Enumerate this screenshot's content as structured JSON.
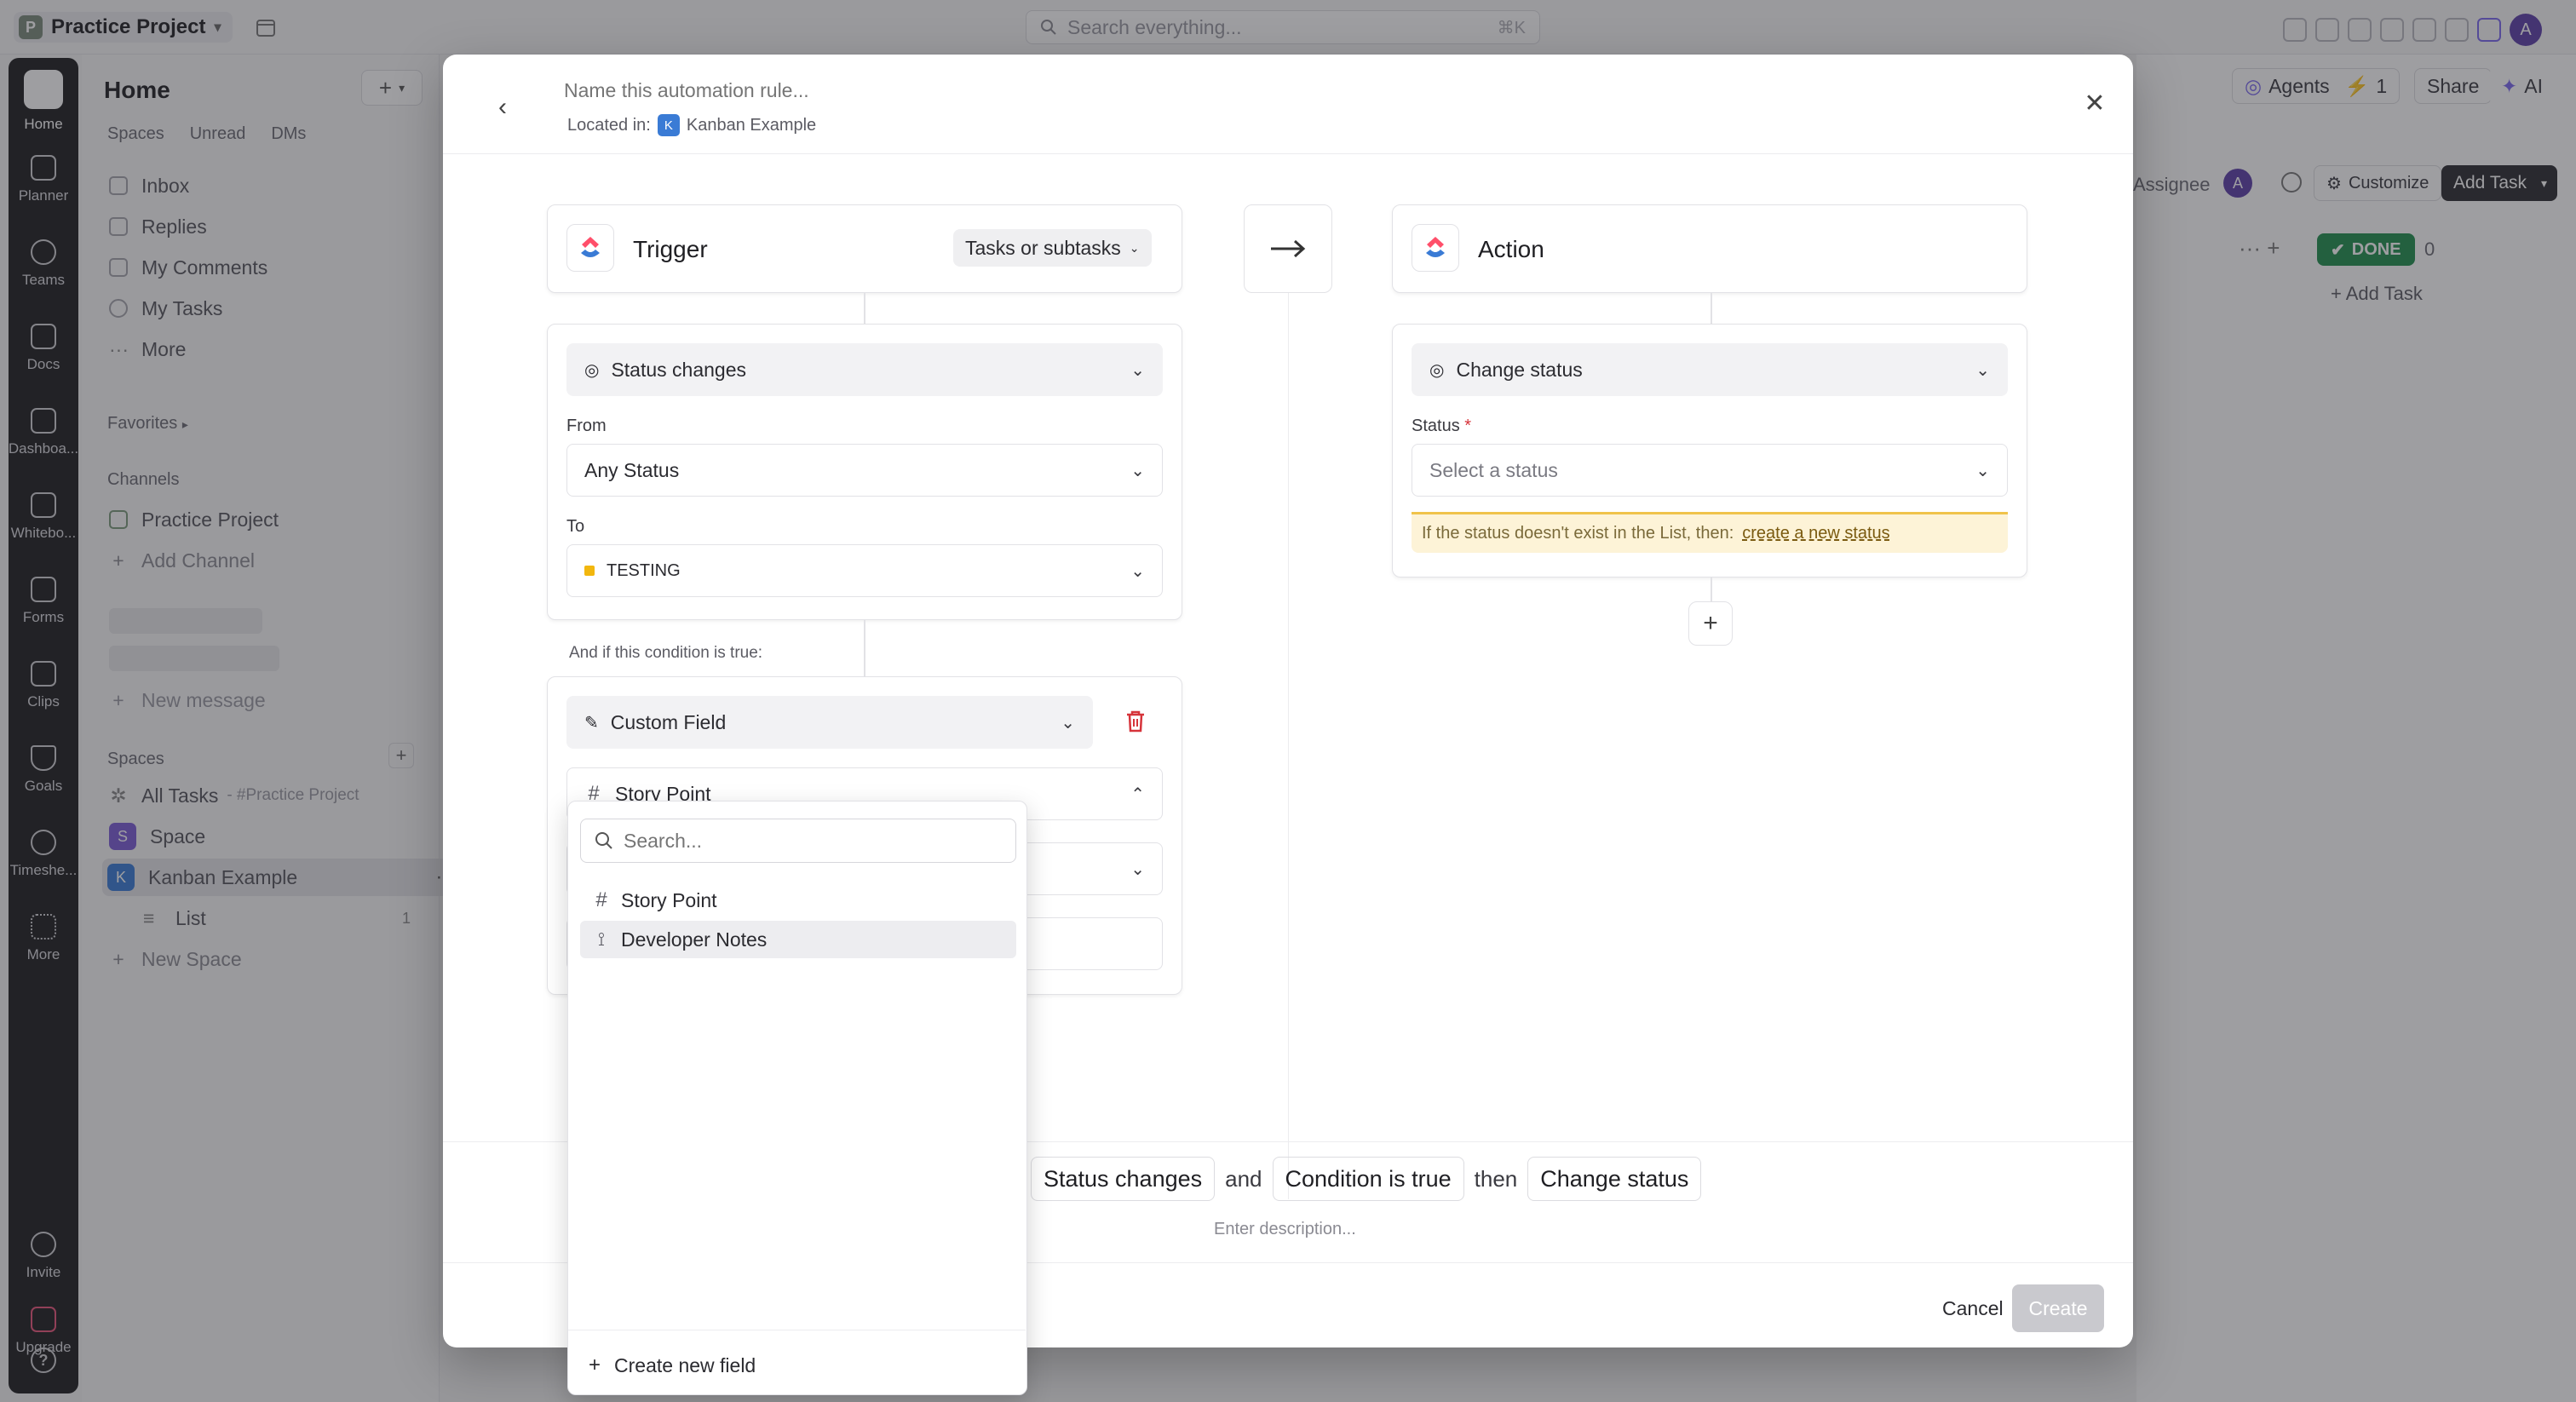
{
  "topbar": {
    "workspace_badge": "P",
    "workspace_name": "Practice Project",
    "search_placeholder": "Search everything...",
    "search_shortcut": "⌘K",
    "user_initial": "A"
  },
  "rail": {
    "items": [
      {
        "label": "Home",
        "icon": "home-icon"
      },
      {
        "label": "Planner",
        "icon": "calendar-icon"
      },
      {
        "label": "Teams",
        "icon": "teams-icon"
      },
      {
        "label": "Docs",
        "icon": "docs-icon"
      },
      {
        "label": "Dashboa...",
        "icon": "dashboard-icon"
      },
      {
        "label": "Whitebo...",
        "icon": "whiteboard-icon"
      },
      {
        "label": "Forms",
        "icon": "forms-icon"
      },
      {
        "label": "Clips",
        "icon": "clips-icon"
      },
      {
        "label": "Goals",
        "icon": "trophy-icon"
      },
      {
        "label": "Timeshe...",
        "icon": "clock-icon"
      },
      {
        "label": "More",
        "icon": "grid-icon"
      }
    ],
    "invite": "Invite",
    "upgrade": "Upgrade",
    "help": "?"
  },
  "sidebar": {
    "title": "Home",
    "tabs": [
      "Spaces",
      "Unread",
      "DMs"
    ],
    "nav": [
      "Inbox",
      "Replies",
      "My Comments",
      "My Tasks",
      "More"
    ],
    "favorites": "Favorites",
    "channels_heading": "Channels",
    "channel": "Practice Project",
    "add_channel": "Add Channel",
    "new_message": "New message",
    "spaces_heading": "Spaces",
    "all_tasks": "All Tasks",
    "all_tasks_suffix": "- #Practice Project",
    "space": "Space",
    "space_badge": "S",
    "kanban": "Kanban Example",
    "kanban_badge": "K",
    "list": "List",
    "list_count": "1",
    "new_space": "New Space"
  },
  "background": {
    "agents": "Agents",
    "bolt_count": "1",
    "share": "Share",
    "ai": "AI",
    "assignee": "Assignee",
    "assignee_initial": "A",
    "customize": "Customize",
    "add_task_button": "Add Task",
    "done_label": "DONE",
    "done_count": "0",
    "add_task_link": "Add Task"
  },
  "modal": {
    "name_placeholder": "Name this automation rule...",
    "located_in_label": "Located in:",
    "location_badge": "K",
    "location": "Kanban Example",
    "trigger": {
      "title": "Trigger",
      "scope": "Tasks or subtasks",
      "event": "Status changes",
      "from_label": "From",
      "from_value": "Any Status",
      "to_label": "To",
      "to_value": "TESTING",
      "to_color": "#f2b70e"
    },
    "condition": {
      "label": "And if this condition is true:",
      "type": "Custom Field",
      "field": "Story Point"
    },
    "action": {
      "title": "Action",
      "event": "Change status",
      "status_label": "Status",
      "required_mark": "*",
      "status_placeholder": "Select a status",
      "warning_text": "If the status doesn't exist in the List, then:",
      "warning_link": "create a new status"
    },
    "summary": {
      "trigger_chip": "Status changes",
      "and": "and",
      "condition_chip": "Condition is true",
      "then": "then",
      "action_chip": "Change status"
    },
    "description_placeholder": "Enter description...",
    "cancel": "Cancel",
    "create": "Create"
  },
  "dropdown": {
    "search_placeholder": "Search...",
    "options": [
      {
        "label": "Story Point",
        "icon": "hash-icon"
      },
      {
        "label": "Developer Notes",
        "icon": "text-field-icon"
      }
    ],
    "create_new": "Create new field"
  },
  "colors": {
    "accent_purple": "#7b68ee",
    "done_green": "#1f8f4e",
    "danger_red": "#d6333a",
    "warning_bg": "#fdf3d7"
  }
}
